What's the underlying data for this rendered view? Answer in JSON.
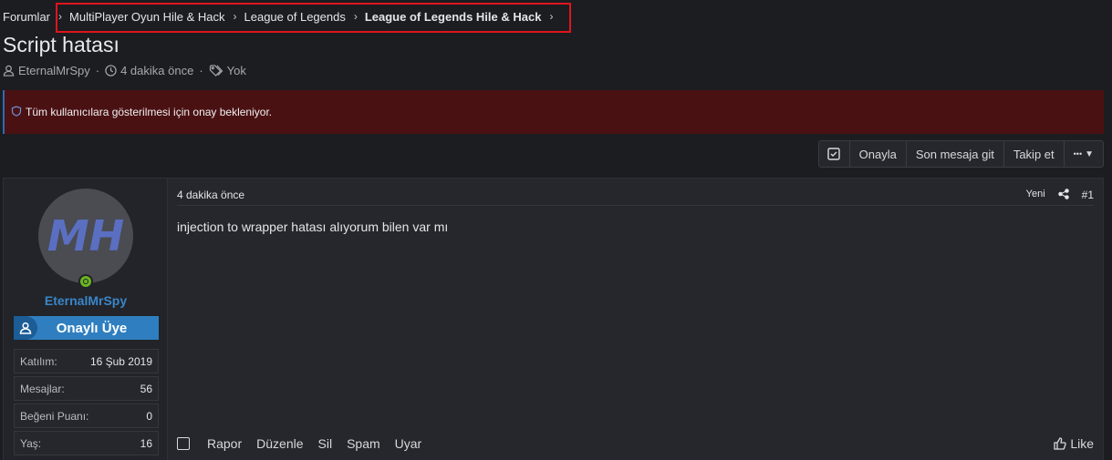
{
  "breadcrumb": {
    "items": [
      "Forumlar",
      "MultiPlayer Oyun Hile & Hack",
      "League of Legends",
      "League of Legends Hile & Hack"
    ]
  },
  "thread": {
    "title": "Script hatası",
    "author": "EternalMrSpy",
    "time": "4 dakika önce",
    "tags": "Yok"
  },
  "notice": {
    "text": "Tüm kullanıcılara gösterilmesi için onay bekleniyor."
  },
  "actions": {
    "approve": "Onayla",
    "last_message": "Son mesaja git",
    "follow": "Takip et",
    "more": "•••"
  },
  "user": {
    "name": "EternalMrSpy",
    "avatar_text": "MH",
    "title": "Onaylı Üye",
    "stats": [
      {
        "key": "Katılım:",
        "value": "16 Şub 2019"
      },
      {
        "key": "Mesajlar:",
        "value": "56"
      },
      {
        "key": "Beğeni Puanı:",
        "value": "0"
      },
      {
        "key": "Yaş:",
        "value": "16"
      }
    ]
  },
  "post": {
    "time": "4 dakika önce",
    "new_label": "Yeni",
    "number": "#1",
    "body": "injection to wrapper hatası alıyorum bilen var mı",
    "footer": {
      "report": "Rapor",
      "edit": "Düzenle",
      "delete": "Sil",
      "spam": "Spam",
      "warn": "Uyar",
      "like": "Like"
    }
  },
  "colors": {
    "background": "#1c1d21",
    "notice_bg": "#4a1113",
    "highlight": "#e0141c",
    "username": "#3a86c8",
    "user_title_bg": "#2f7fc0",
    "online": "#6ab521"
  }
}
